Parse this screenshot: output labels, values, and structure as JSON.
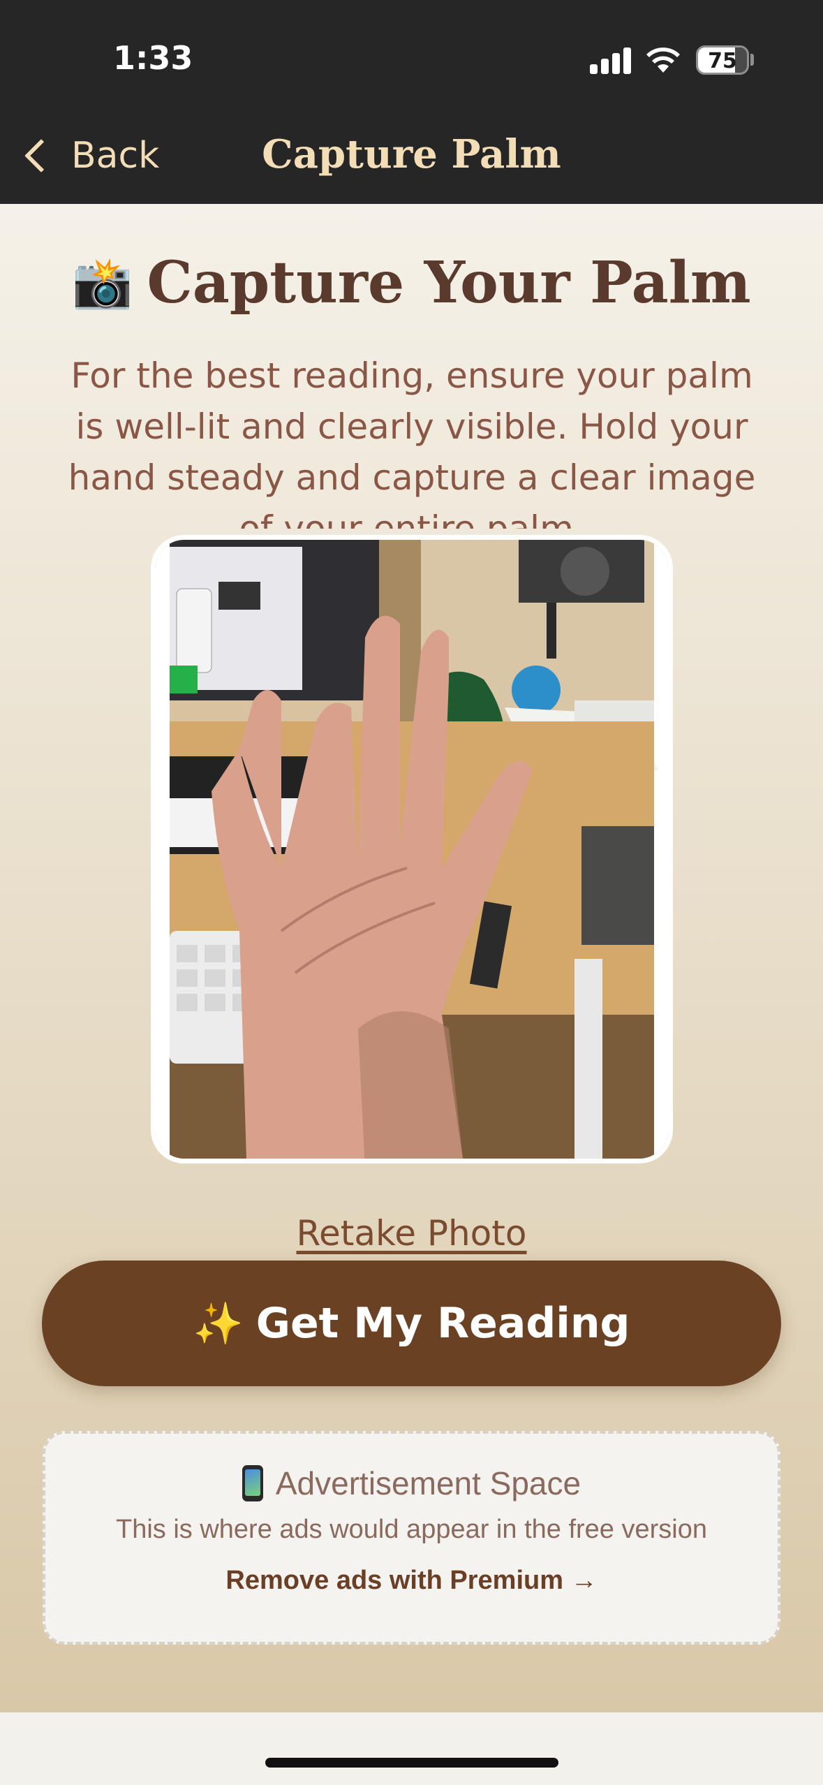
{
  "status_bar": {
    "time": "1:33",
    "battery": "75"
  },
  "nav": {
    "back_label": "Back",
    "title": "Capture Palm"
  },
  "main": {
    "heading_icon": "📸",
    "heading": "Capture Your Palm",
    "description": "For the best reading, ensure your palm is well-lit and clearly visible. Hold your hand steady and capture a clear image of your entire palm.",
    "retake_label": "Retake Photo",
    "cta_icon": "✨",
    "cta_label": "Get My Reading"
  },
  "ad": {
    "title": "Advertisement Space",
    "subtitle": "This is where ads would appear in the free version",
    "link": "Remove ads with Premium →"
  },
  "colors": {
    "nav_bg": "#262626",
    "nav_text": "#f2ddb6",
    "heading": "#5a3a2c",
    "cta_bg": "#6b4124"
  }
}
